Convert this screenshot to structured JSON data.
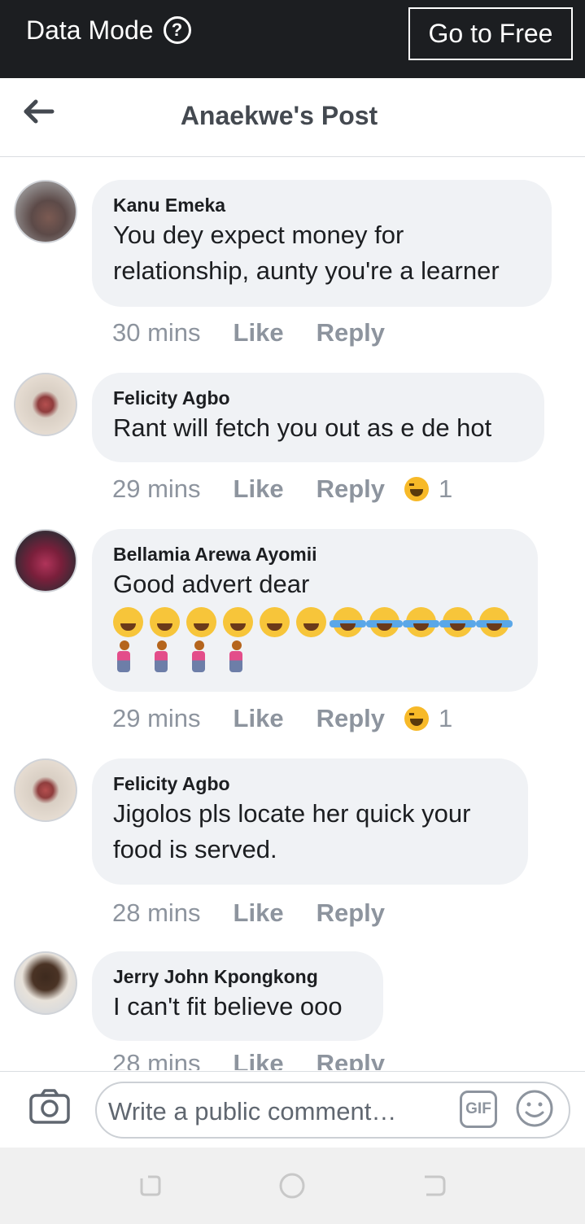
{
  "top_bar": {
    "mode_label": "Data Mode",
    "help_symbol": "?",
    "goto_button": "Go to Free"
  },
  "header": {
    "title": "Anaekwe's Post"
  },
  "comments": [
    {
      "name": "Kanu Emeka",
      "text": "You dey expect money for relationship, aunty you're a learner",
      "time": "30 mins",
      "like": "Like",
      "reply": "Reply"
    },
    {
      "name": "Felicity Agbo",
      "text": "Rant will fetch you out as e de hot",
      "time": "29 mins",
      "like": "Like",
      "reply": "Reply",
      "reaction_count": "1"
    },
    {
      "name": "Bellamia Arewa Ayomii",
      "text": "Good advert dear",
      "time": "29 mins",
      "like": "Like",
      "reply": "Reply",
      "reaction_count": "1"
    },
    {
      "name": "Felicity Agbo",
      "text": "Jigolos pls locate her quick your food is served.",
      "time": "28 mins",
      "like": "Like",
      "reply": "Reply"
    },
    {
      "name": "Jerry John Kpongkong",
      "text": "I can't fit believe ooo",
      "time": "28 mins",
      "like": "Like",
      "reply": "Reply"
    }
  ],
  "composer": {
    "placeholder": "Write a public comment…",
    "gif_label": "GIF"
  },
  "icons": {
    "back": "back-arrow-icon",
    "help": "help-icon",
    "camera": "camera-icon",
    "gif": "gif-icon",
    "emoji": "emoji-icon",
    "reaction": "haha-reaction-icon"
  }
}
